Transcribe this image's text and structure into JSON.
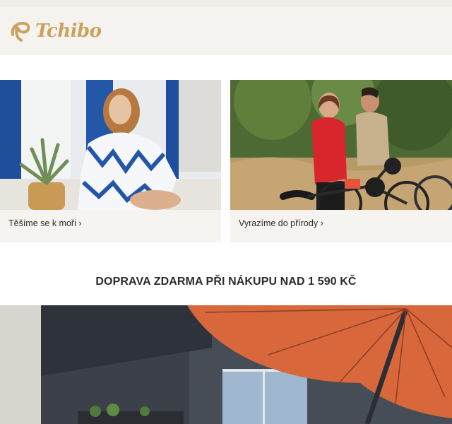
{
  "header": {
    "logo_text": "Tchibo",
    "logo_color": "#c9a25f"
  },
  "cards": [
    {
      "link_text": "Těšíme se k moři",
      "chevron": "›"
    },
    {
      "link_text": "Vyrazíme do přírody",
      "chevron": "›"
    }
  ],
  "banner": {
    "text": "DOPRAVA ZDARMA PŘI NÁKUPU NAD 1 590 KČ"
  },
  "hero": {
    "image": "orange-parasol-terrace-icon"
  }
}
